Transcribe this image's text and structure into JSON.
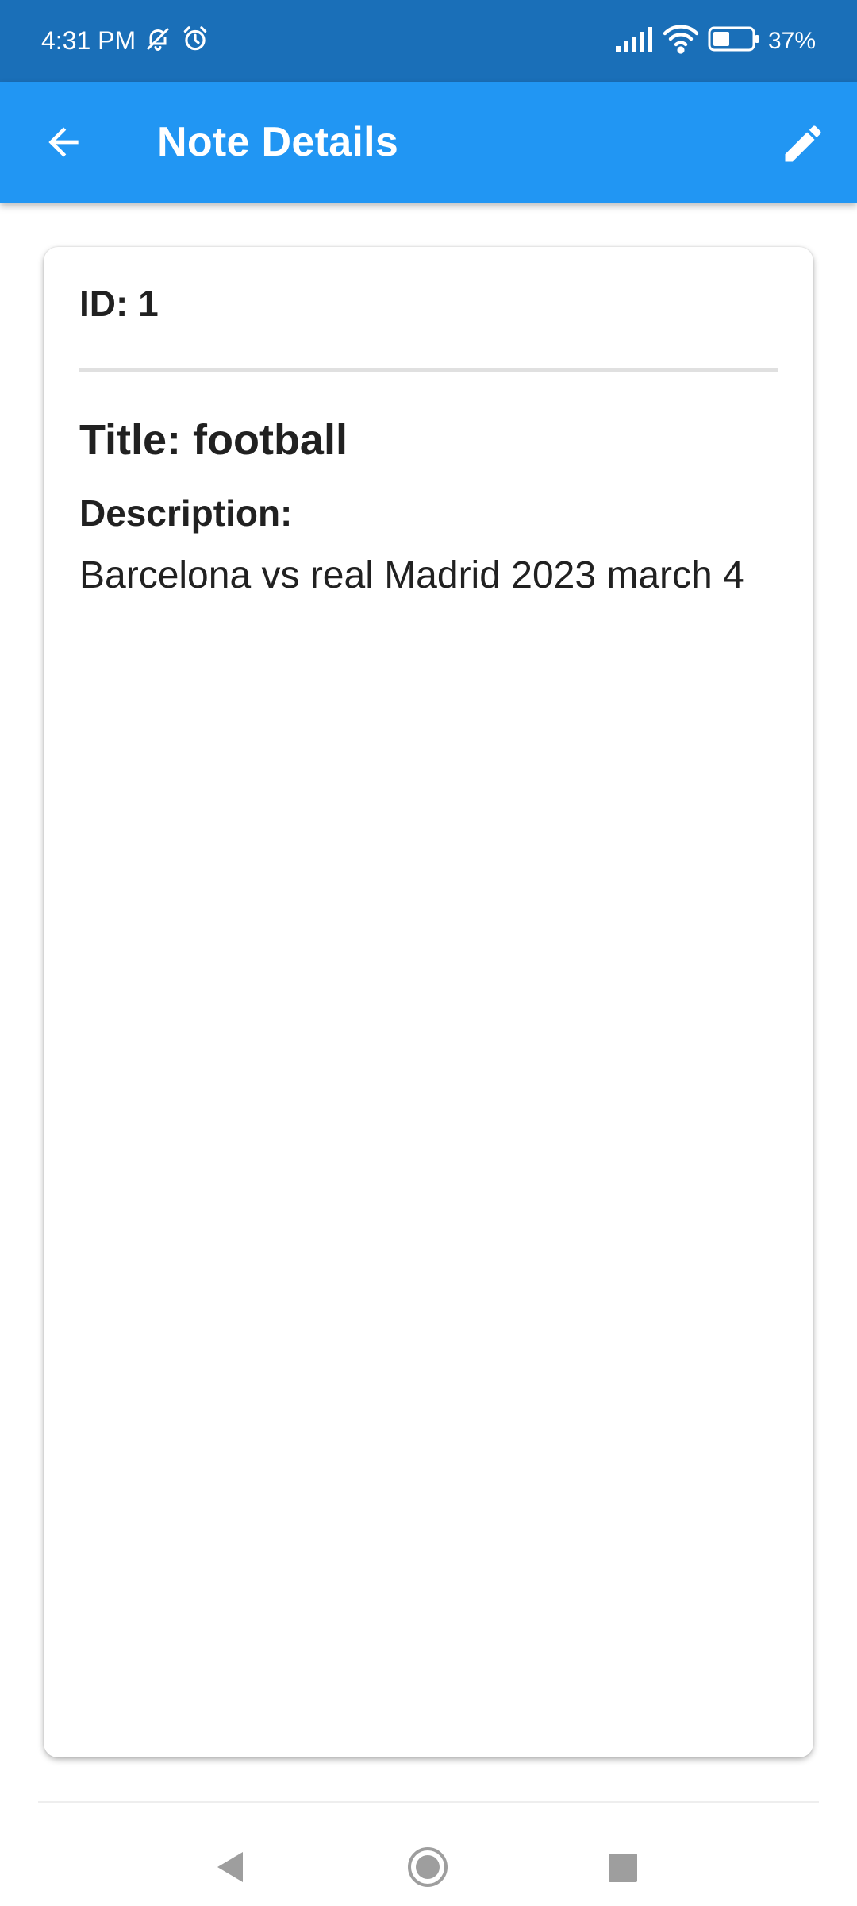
{
  "status_bar": {
    "time": "4:31 PM",
    "battery_text": "37%",
    "icons": [
      "notifications-off-icon",
      "alarm-icon",
      "signal-icon",
      "wifi-icon",
      "battery-icon"
    ]
  },
  "app_bar": {
    "title": "Note Details",
    "back_icon": "arrow-back-icon",
    "edit_icon": "pencil-icon",
    "color": "#2196f3"
  },
  "note": {
    "id_text": "ID: 1",
    "title_text": "Title: football",
    "description_label": "Description:",
    "description_text": "Barcelona vs real Madrid 2023 march 4"
  },
  "nav_bar": {
    "icons": [
      "nav-back-icon",
      "nav-home-icon",
      "nav-recents-icon"
    ]
  },
  "colors": {
    "status_bar": "#1a6fb8",
    "app_bar": "#2196f3",
    "text": "#212121",
    "divider": "#e0e0e0"
  }
}
